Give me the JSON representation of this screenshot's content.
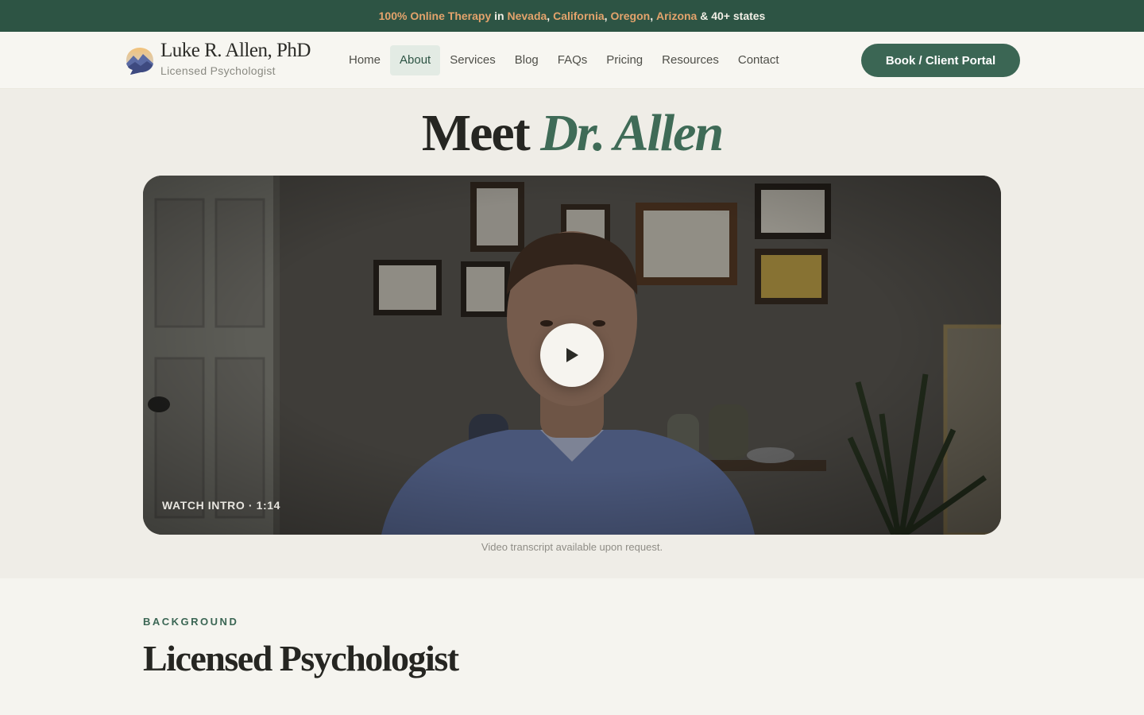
{
  "announcement": {
    "part1": "100% Online Therapy",
    "part2": " in ",
    "state1": "Nevada",
    "sep1": ", ",
    "state2": "California",
    "sep2": ", ",
    "state3": "Oregon",
    "sep3": ", ",
    "state4": "Arizona",
    "part3": " & 40+ states"
  },
  "brand": {
    "name": "Luke R. Allen, PhD",
    "subtitle": "Licensed Psychologist",
    "logo_icon": "mountain-speech-bubble-icon"
  },
  "nav": {
    "items": [
      {
        "label": "Home",
        "active": false
      },
      {
        "label": "About",
        "active": true
      },
      {
        "label": "Services",
        "active": false
      },
      {
        "label": "Blog",
        "active": false
      },
      {
        "label": "FAQs",
        "active": false
      },
      {
        "label": "Pricing",
        "active": false
      },
      {
        "label": "Resources",
        "active": false
      },
      {
        "label": "Contact",
        "active": false
      }
    ],
    "cta_label": "Book / Client Portal"
  },
  "hero": {
    "title_plain": "Meet ",
    "title_accent": "Dr. Allen",
    "video_label": "WATCH INTRO · 1:14",
    "play_icon": "play-icon",
    "caption": "Video transcript available upon request."
  },
  "background_section": {
    "eyebrow": "BACKGROUND",
    "title": "Licensed Psychologist"
  },
  "colors": {
    "primary": "#2d5444",
    "accent": "#e3a36c",
    "button": "#3b6654",
    "nav_active_bg": "#e3ebe4"
  }
}
